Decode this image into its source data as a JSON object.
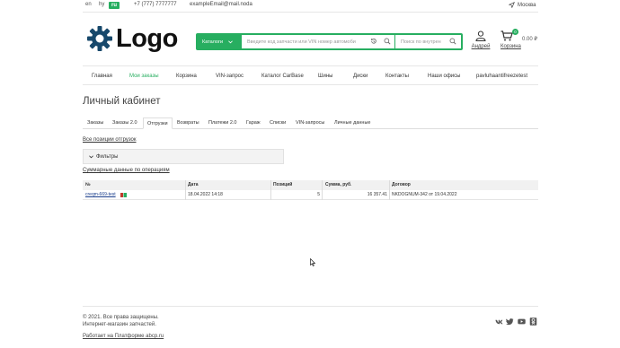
{
  "topbar": {
    "languages": [
      "en",
      "hy",
      "ru"
    ],
    "active_language": "ru",
    "phone": "+7 (777) 7777777",
    "email": "exampleEmail@mail.noda",
    "city": "Москва"
  },
  "logo": {
    "text": "Logo"
  },
  "search": {
    "catalog_label": "Каталоги",
    "main_placeholder": "Введите код запчасти или VIN номер автомоби",
    "side_placeholder": "Поиск по внутрен"
  },
  "account": {
    "label": "Андрей"
  },
  "cart": {
    "count": "0",
    "sum": "0.00 ₽",
    "label": "Корзина"
  },
  "nav": {
    "items": [
      "Главная",
      "Мои заказы",
      "Корзина",
      "VIN-запрос",
      "Каталог CarBase",
      "Шины",
      "Диски",
      "Контакты",
      "Наши офисы",
      "pavluhaantifreezetest"
    ],
    "active": "Мои заказы"
  },
  "page": {
    "title": "Личный кабинет"
  },
  "tabs": {
    "items": [
      "Заказы",
      "Заказы 2.0",
      "Отгрузки",
      "Возвраты",
      "Платежи 2.0",
      "Гараж",
      "Списки",
      "VIN-запросы",
      "Личные данные"
    ],
    "active": "Отгрузки"
  },
  "links": {
    "all_positions": "Все позиции отгрузок",
    "filters": "Фильтры",
    "summary": "Суммарные данные по операциям"
  },
  "table": {
    "columns": [
      "№",
      "Дата",
      "Позиций",
      "Сумма, руб.",
      "Договор"
    ],
    "rows": [
      {
        "number": "сreqm-669-test",
        "date": "18.04.2022 14:18",
        "positions": "5",
        "sum": "16 357.41",
        "contract": "NKDOGNUM-342 от 19.04.2022"
      }
    ]
  },
  "footer": {
    "copyright": "© 2021. Все права защищены.",
    "tagline": "Интернет-магазин запчастей.",
    "powered": "Работает на Платформе abcp.ru",
    "social_icons": [
      "vk-icon",
      "twitter-icon",
      "youtube-icon",
      "odnoklassniki-icon"
    ]
  },
  "colors": {
    "accent": "#27ae60"
  }
}
